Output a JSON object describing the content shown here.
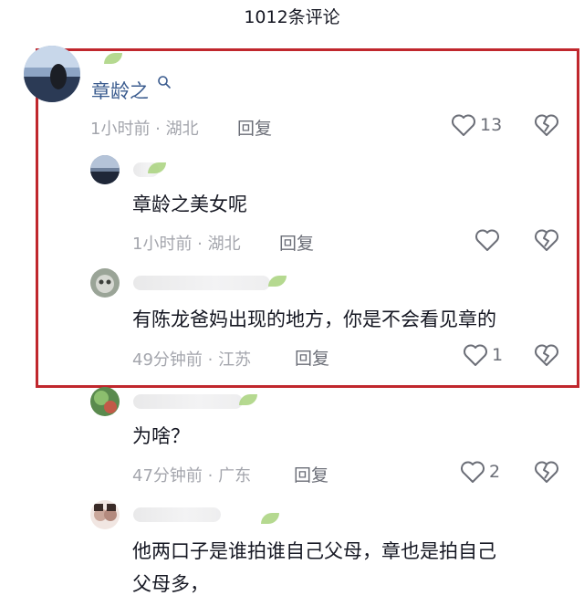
{
  "header": {
    "title": "1012条评论"
  },
  "colors": {
    "highlight_border": "#c0272d",
    "username": "#3b5c8f",
    "meta": "#a4a6ad",
    "icon": "#6b6e77"
  },
  "comments": [
    {
      "username": "章龄之",
      "username_icon": "search-icon",
      "text": "",
      "meta": "1小时前 · 湖北",
      "reply": "回复",
      "likes": "13"
    },
    {
      "username": "",
      "text": "章龄之美女呢",
      "meta": "1小时前 · 湖北",
      "reply": "回复",
      "likes": ""
    },
    {
      "username": "",
      "text": "有陈龙爸妈出现的地方，你是不会看见章的",
      "meta": "49分钟前 · 江苏",
      "reply": "回复",
      "likes": "1"
    },
    {
      "username": "",
      "text": "为啥？",
      "meta": "47分钟前 · 广东",
      "reply": "回复",
      "likes": "2"
    },
    {
      "username": "",
      "text_lines": [
        "他两口子是谁拍谁自己父母，章也是拍自己",
        "父母多，"
      ],
      "meta": "",
      "reply": "",
      "likes": ""
    }
  ]
}
